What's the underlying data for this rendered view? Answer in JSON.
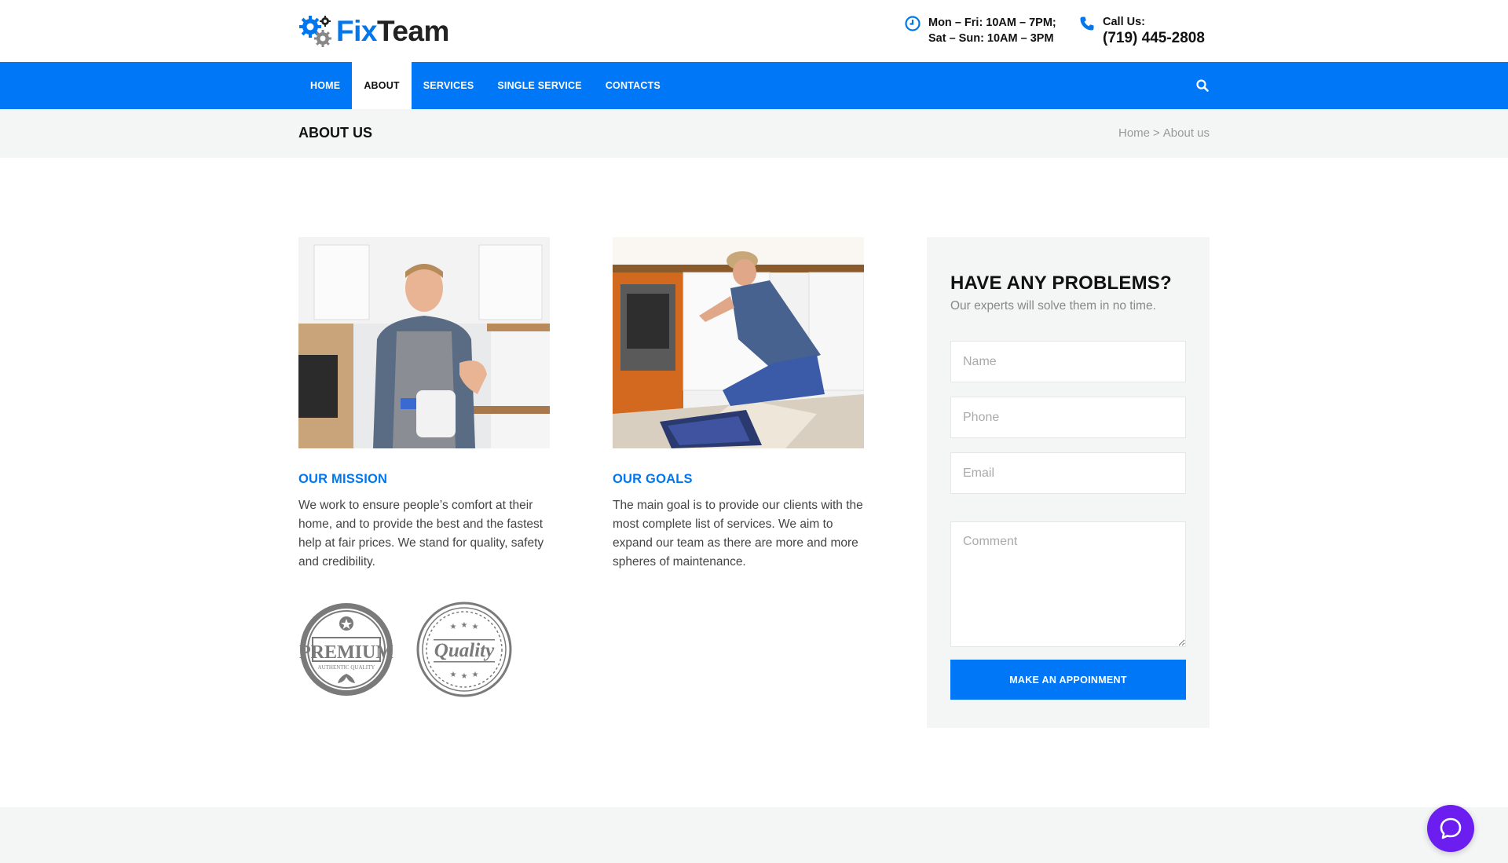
{
  "brand": {
    "fix": "Fix",
    "team": "Team",
    "accent": "#0077f6"
  },
  "header": {
    "hours_line1": "Mon – Fri: 10AM – 7PM;",
    "hours_line2": "Sat – Sun: 10AM – 3PM",
    "call_label": "Call Us:",
    "phone": "(719) 445-2808"
  },
  "nav": {
    "items": [
      "HOME",
      "ABOUT",
      "SERVICES",
      "SINGLE SERVICE",
      "CONTACTS"
    ],
    "active": "ABOUT"
  },
  "page": {
    "title": "ABOUT US",
    "breadcrumb": {
      "home": "Home",
      "sep": ">",
      "current": "About us"
    }
  },
  "mission": {
    "title": "OUR MISSION",
    "text": "We work to ensure people’s comfort at their home, and to provide the best and the fastest help at fair prices. We stand for quality, safety and credibility."
  },
  "goals": {
    "title": "OUR GOALS",
    "text": "The main goal is to provide our clients with the most complete list of services. We aim to expand our team as there are more and more spheres of maintenance."
  },
  "badges": {
    "premium": "PREMIUM",
    "premium_sub": "AUTHENTIC QUALITY",
    "quality": "Quality"
  },
  "form": {
    "title": "HAVE ANY PROBLEMS?",
    "subtitle": "Our experts will solve them in no time.",
    "name_placeholder": "Name",
    "phone_placeholder": "Phone",
    "email_placeholder": "Email",
    "comment_placeholder": "Comment",
    "submit_label": "MAKE AN APPOINMENT"
  },
  "icons": {
    "clock": "clock-icon",
    "phone": "phone-icon",
    "search": "search-icon",
    "chat": "chat-icon"
  }
}
